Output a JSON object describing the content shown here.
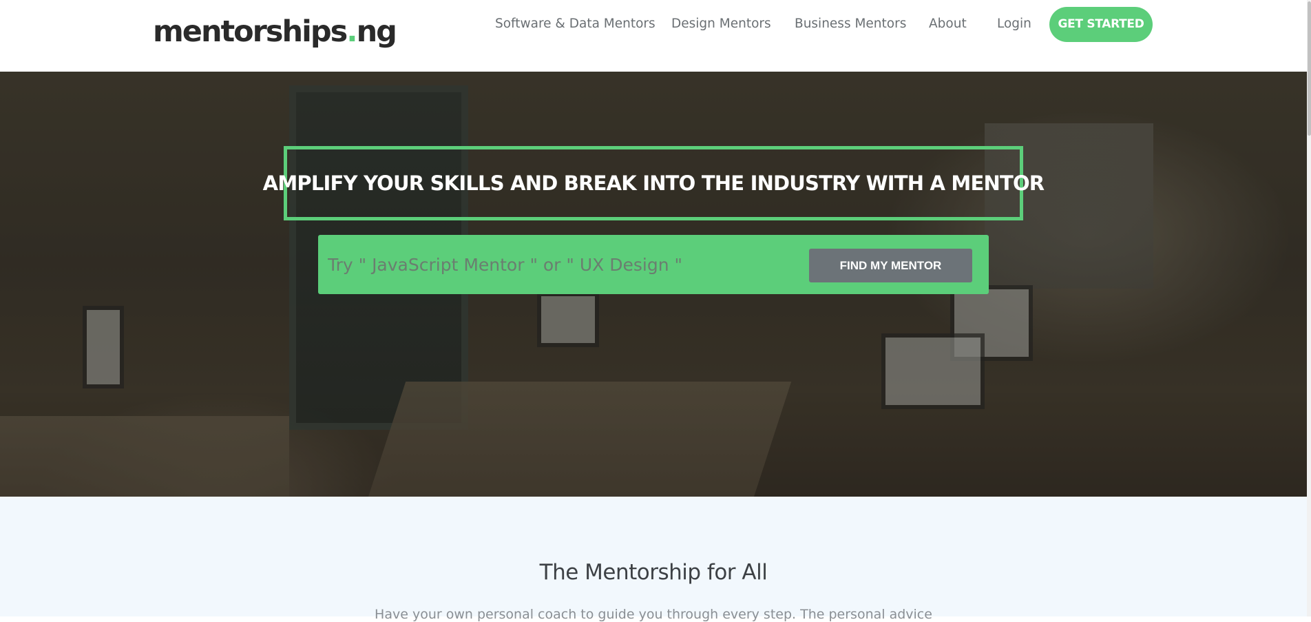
{
  "header": {
    "logo_main": "mentorships",
    "logo_dot": ".",
    "logo_tld": "ng",
    "nav": [
      {
        "label": "Software & Data Mentors"
      },
      {
        "label": "Design Mentors"
      },
      {
        "label": "Business Mentors"
      },
      {
        "label": "About"
      },
      {
        "label": "Login"
      }
    ],
    "cta_label": "GET STARTED"
  },
  "hero": {
    "headline": "AMPLIFY YOUR SKILLS AND BREAK INTO THE INDUSTRY WITH A MENTOR",
    "search_placeholder": "Try \" JavaScript Mentor \" or \" UX Design \"",
    "search_value": "",
    "search_button_label": "FIND MY MENTOR"
  },
  "section": {
    "title": "The Mentorship for All",
    "text": "Have your own personal coach to guide you through every step. The personal advice"
  },
  "colors": {
    "accent": "#5cce7a",
    "button_gray": "#6c7378",
    "section_bg": "#f2f8fd"
  }
}
